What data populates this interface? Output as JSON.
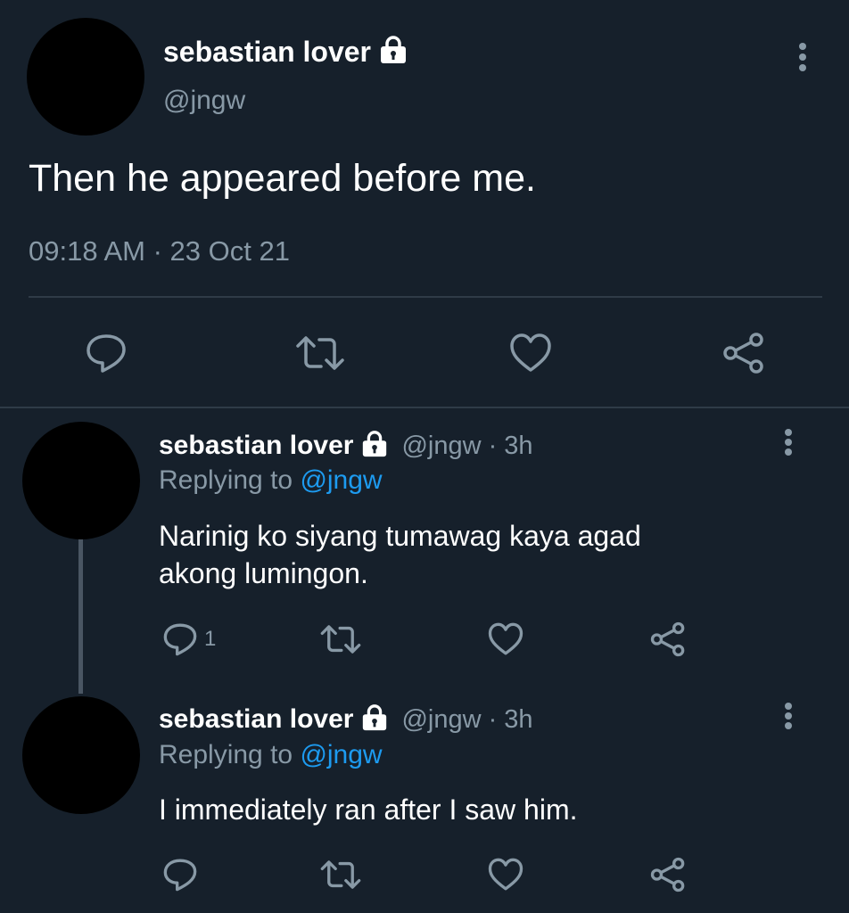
{
  "main_tweet": {
    "display_name": "sebastian lover",
    "handle": "@jngw",
    "text": "Then he appeared before me.",
    "timestamp": "09:18 AM · 23 Oct 21",
    "actions": [
      "reply-icon",
      "retweet-icon",
      "like-icon",
      "share-icon"
    ]
  },
  "replies": [
    {
      "display_name": "sebastian lover",
      "meta": "@jngw · 3h",
      "replying_prefix": "Replying to",
      "replying_handle": "@jngw",
      "text_line1": "Narinig ko siyang tumawag kaya agad",
      "text_line2": "akong lumingon.",
      "reply_count": "1"
    },
    {
      "display_name": "sebastian lover",
      "meta": "@jngw · 3h",
      "replying_prefix": "Replying to",
      "replying_handle": "@jngw",
      "text_line1": "I immediately ran after I saw him.",
      "reply_count": ""
    }
  ],
  "colors": {
    "background": "#16202b",
    "muted": "#8899a6",
    "link": "#1d9bf0",
    "separator": "#2f3b47"
  }
}
